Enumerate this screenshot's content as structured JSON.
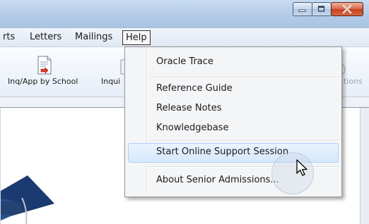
{
  "menubar": {
    "items": [
      "rts",
      "Letters",
      "Mailings",
      "Help"
    ]
  },
  "toolbar": {
    "inq_app_by_school": "Inq/App by School",
    "inquiries_partial": "Inqui",
    "options_partial": "tions"
  },
  "help_menu": {
    "items": [
      "Oracle Trace",
      "Reference Guide",
      "Release Notes",
      "Knowledgebase",
      "Start Online Support Session",
      "About Senior Admissions..."
    ],
    "highlighted_index": 4
  },
  "icons": {
    "window_minimize": "minimize-icon",
    "window_maximize": "maximize-icon",
    "window_close": "close-icon",
    "report_doc": "document-report-icon",
    "grad_cap": "graduation-cap-icon",
    "mouse_cursor": "arrow-cursor-icon"
  },
  "colors": {
    "titlebar": "#b3cbe6",
    "close_button": "#c7401d",
    "menu_highlight": "#d6e8fc",
    "grad_cap": "#1b3a70"
  }
}
